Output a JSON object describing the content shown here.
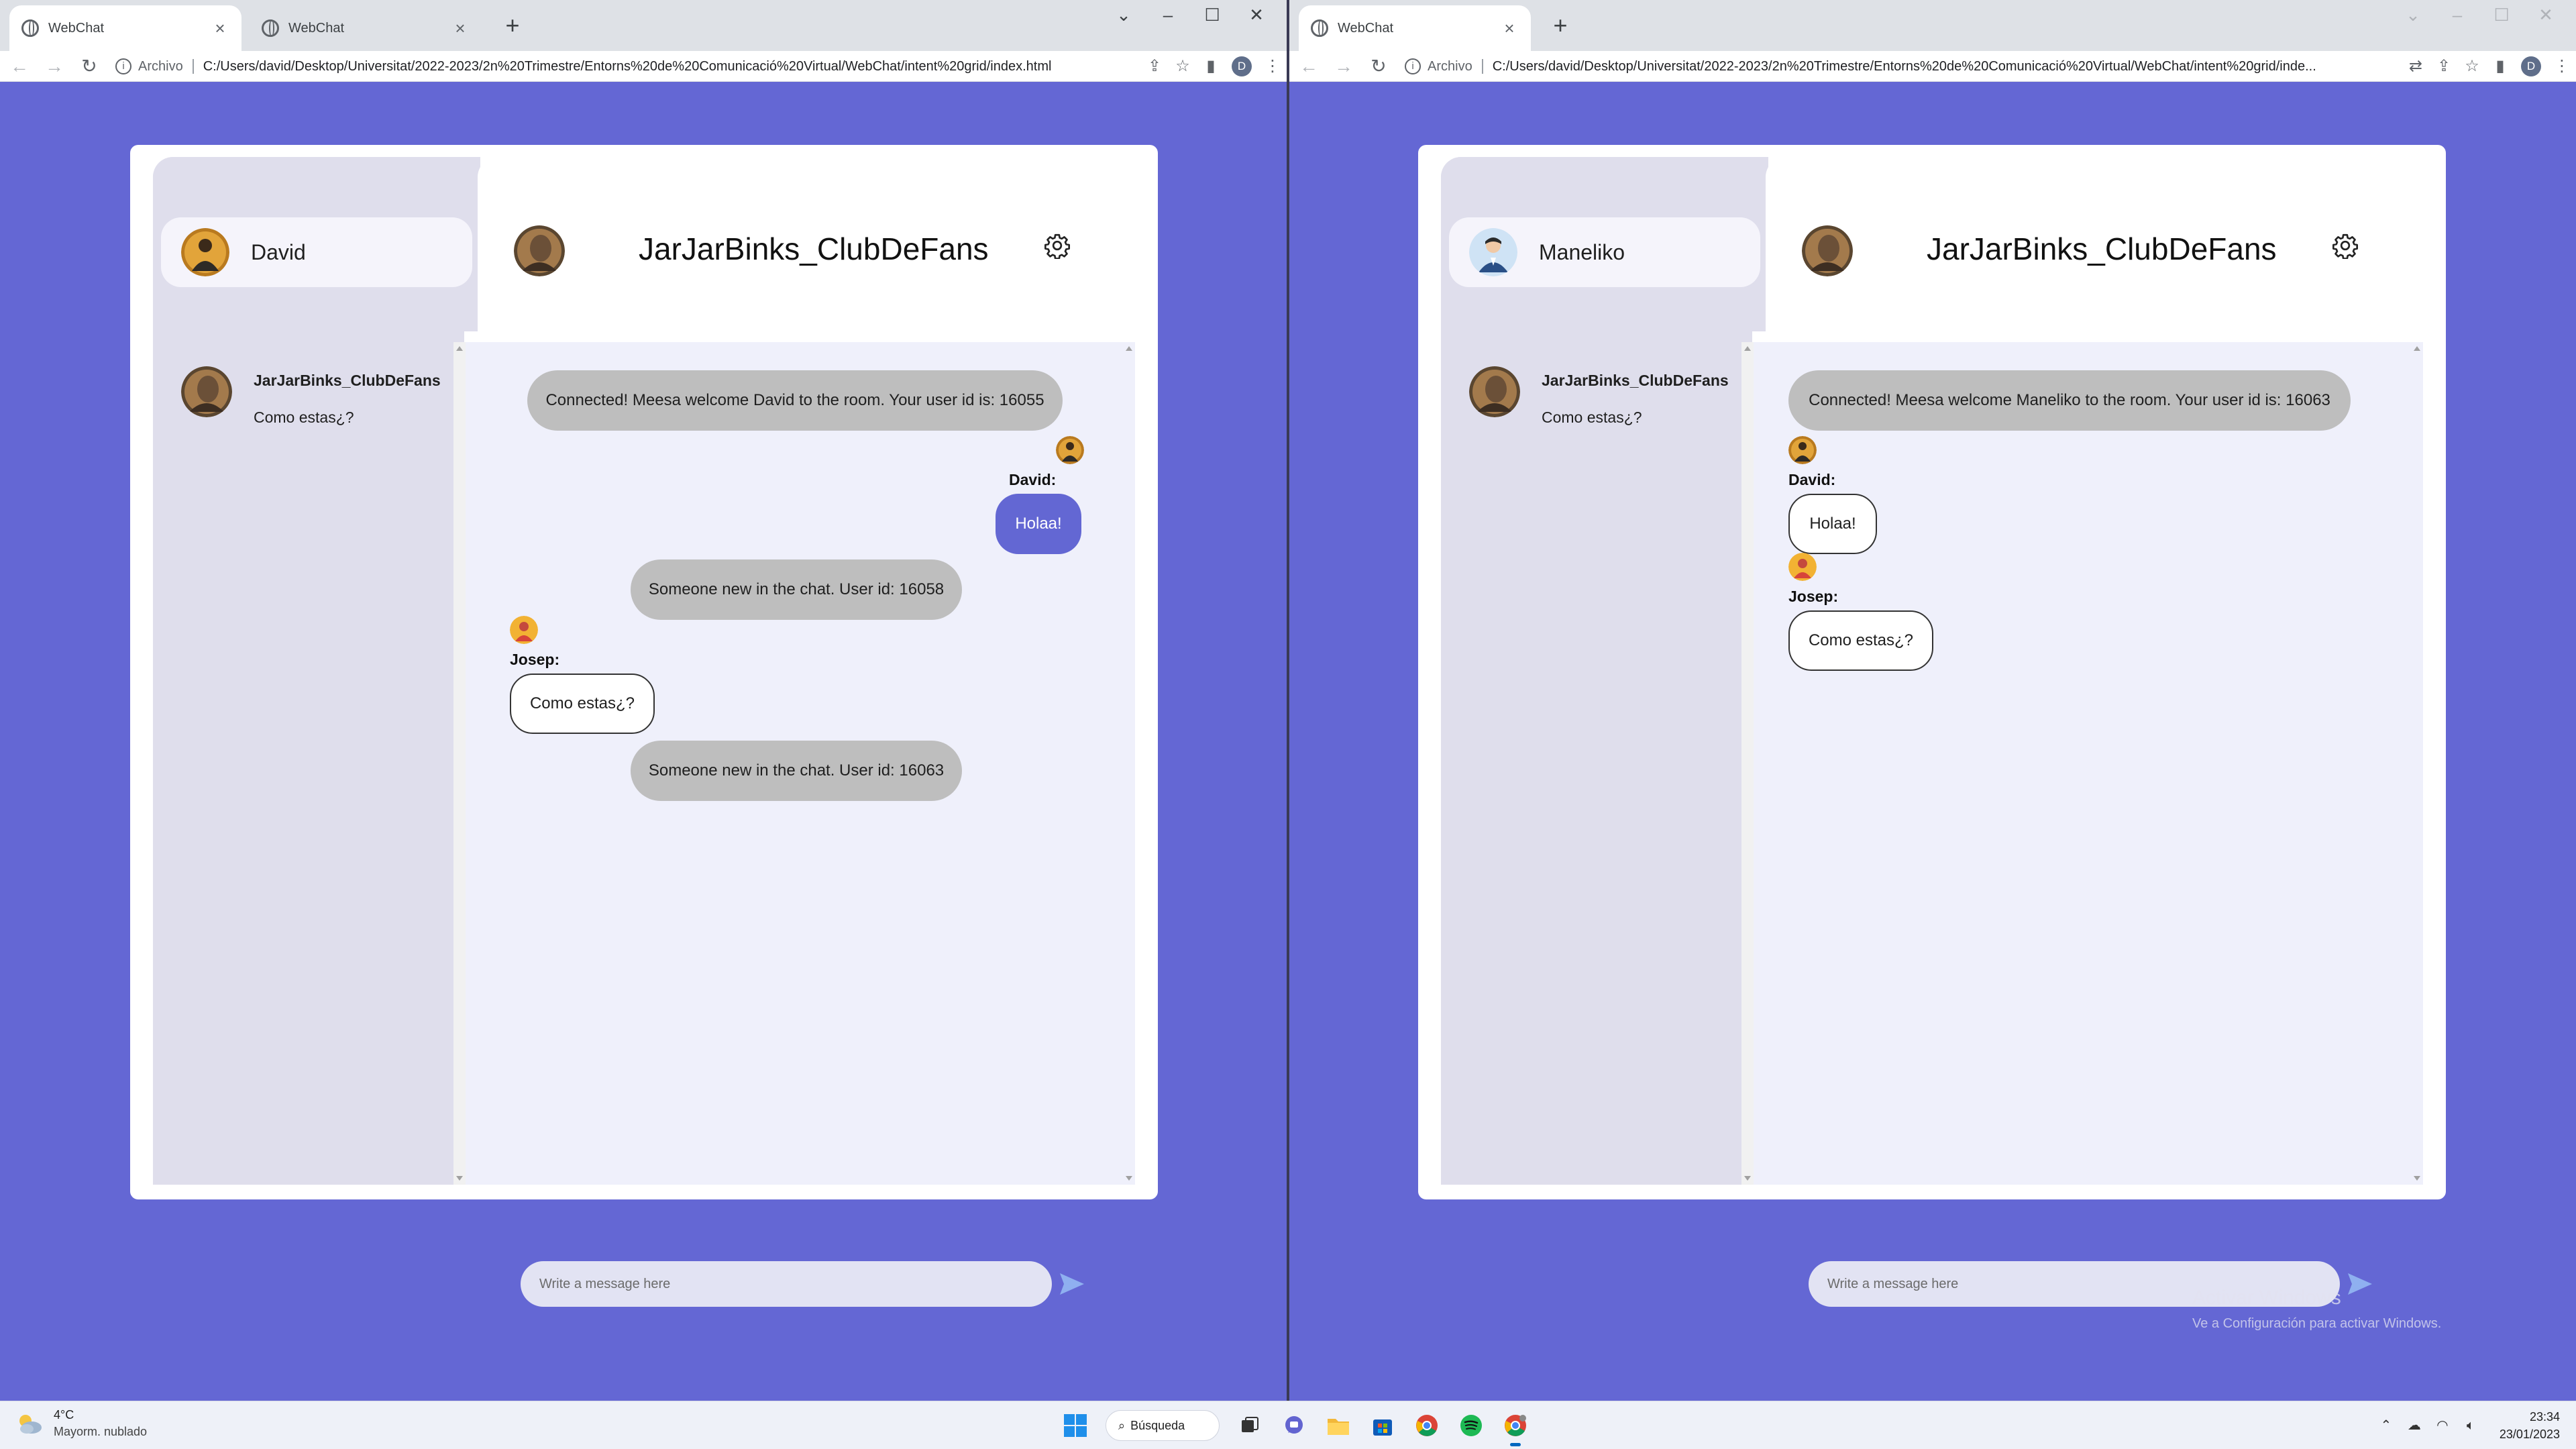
{
  "windows": [
    {
      "tabs": [
        {
          "title": "WebChat",
          "active": true
        },
        {
          "title": "WebChat",
          "active": false
        }
      ],
      "address": {
        "scheme": "Archivo",
        "url": "C:/Users/david/Desktop/Universitat/2022-2023/2n%20Trimestre/Entorns%20de%20Comunicació%20Virtual/WebChat/intent%20grid/index.html"
      },
      "profile_initial": "D",
      "app": {
        "current_user": "David",
        "chat_list": [
          {
            "name": "JarJarBinks_ClubDeFans",
            "preview": "Como estas¿?"
          }
        ],
        "room_title": "JarJarBinks_ClubDeFans",
        "messages": [
          {
            "type": "system",
            "text": "Connected! Meesa welcome David to the room. Your user id is: 16055"
          },
          {
            "type": "mine",
            "sender": "David:",
            "text": "Holaa!"
          },
          {
            "type": "system",
            "text": "Someone new in the chat. User id: 16058"
          },
          {
            "type": "other",
            "sender": "Josep:",
            "text": "Como estas¿?"
          },
          {
            "type": "system",
            "text": "Someone new in the chat. User id: 16063"
          }
        ],
        "composer_placeholder": "Write a message here"
      }
    },
    {
      "tabs": [
        {
          "title": "WebChat",
          "active": true
        }
      ],
      "address": {
        "scheme": "Archivo",
        "url": "C:/Users/david/Desktop/Universitat/2022-2023/2n%20Trimestre/Entorns%20de%20Comunicació%20Virtual/WebChat/intent%20grid/inde..."
      },
      "profile_initial": "D",
      "app": {
        "current_user": "Maneliko",
        "chat_list": [
          {
            "name": "JarJarBinks_ClubDeFans",
            "preview": "Como estas¿?"
          }
        ],
        "room_title": "JarJarBinks_ClubDeFans",
        "messages": [
          {
            "type": "system",
            "text": "Connected! Meesa welcome Maneliko to the room. Your user id is: 16063"
          },
          {
            "type": "other",
            "sender": "David:",
            "text": "Holaa!"
          },
          {
            "type": "other",
            "sender": "Josep:",
            "text": "Como estas¿?"
          }
        ],
        "composer_placeholder": "Write a message here"
      }
    }
  ],
  "windows_activation": {
    "title": "Activar Windows",
    "subtitle": "Ve a Configuración para activar Windows."
  },
  "taskbar": {
    "weather": {
      "temp": "4°C",
      "condition": "Mayorm. nublado"
    },
    "search_label": "Búsqueda",
    "clock": {
      "time": "23:34",
      "date": "23/01/2023"
    },
    "pinned_apps": [
      "start-icon",
      "search",
      "task-view-icon",
      "teams-chat-icon",
      "file-explorer-icon",
      "store-icon",
      "chrome-icon",
      "spotify-icon",
      "chrome-dev-icon"
    ]
  },
  "colors": {
    "accent": "#6367d3",
    "sidebar": "#dfdeec",
    "messages_bg": "#eff0fb",
    "system_bubble": "#bebebe"
  }
}
